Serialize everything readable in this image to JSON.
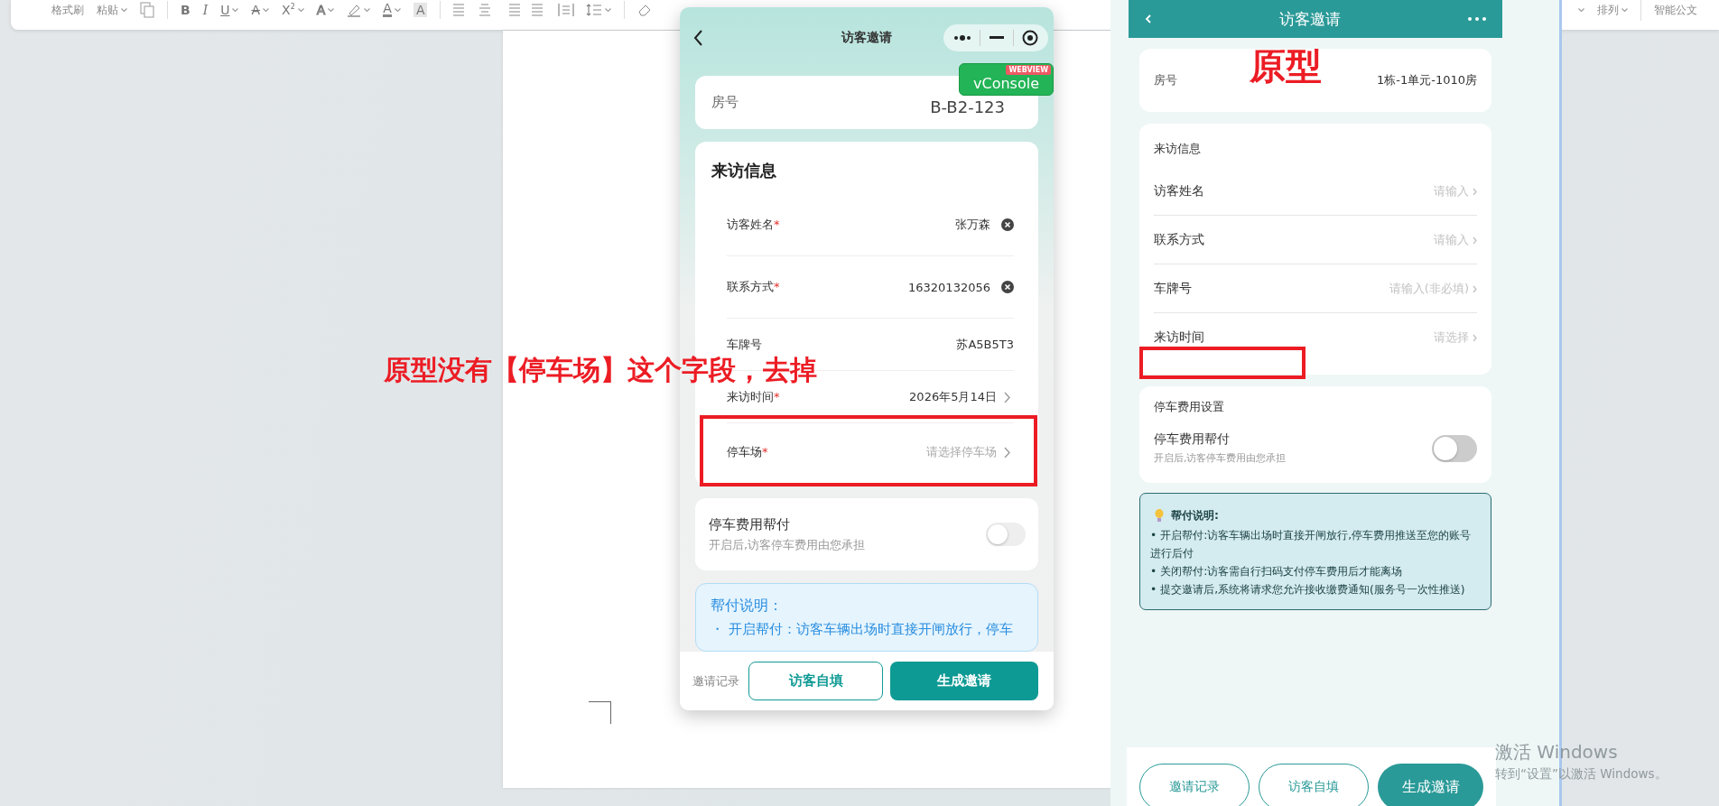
{
  "toolbar": {
    "left_items": [
      {
        "label": "格式刷",
        "dropdown": false
      },
      {
        "label": "粘贴",
        "dropdown": true
      }
    ],
    "format_buttons": [
      {
        "glyph": "B",
        "kind": "bold",
        "dropdown": false
      },
      {
        "glyph": "I",
        "kind": "italic",
        "dropdown": false
      },
      {
        "glyph": "U",
        "kind": "underline",
        "dropdown": true
      },
      {
        "glyph": "A",
        "kind": "strike",
        "dropdown": true
      },
      {
        "glyph": "X$^{2}$",
        "kind": "super",
        "dropdown": true
      },
      {
        "glyph": "A",
        "kind": "outline",
        "dropdown": true
      },
      {
        "glyph": "A",
        "kind": "color",
        "dropdown": true
      },
      {
        "glyph": "A",
        "kind": "shaded",
        "dropdown": false
      }
    ],
    "right_items": [
      {
        "label": "排列",
        "dropdown": true
      },
      {
        "label": "智能公文",
        "dropdown": false
      }
    ]
  },
  "preview": {
    "title": "访客邀请",
    "vconsole": {
      "label": "vConsole",
      "ribbon": "WEBVIEW"
    },
    "room": {
      "label": "房号",
      "value": "B-B2-123"
    },
    "section_title": "来访信息",
    "fields": [
      {
        "label": "访客姓名",
        "asterisk": "*",
        "value": "张万森",
        "kind": "clearable"
      },
      {
        "label": "联系方式",
        "asterisk": "*",
        "value": "16320132056",
        "kind": "clearable"
      },
      {
        "label": "车牌号",
        "value": "苏A5B5T3",
        "kind": "text"
      },
      {
        "label": "来访时间",
        "asterisk": "*",
        "value": "2026年5月14日",
        "kind": "picker"
      },
      {
        "label": "停车场",
        "asterisk": "*",
        "placeholder": "请选择停车场",
        "kind": "picker"
      }
    ],
    "fee": {
      "title": "停车费用帮付",
      "note": "开启后,访客停车费用由您承担",
      "on": false
    },
    "help": {
      "title": "帮付说明：",
      "lines": [
        "・ 开启帮付：访客车辆出场时直接开闸放行，停车"
      ]
    },
    "bottom": {
      "link": "邀请记录",
      "secondary": "访客自填",
      "primary": "生成邀请"
    }
  },
  "prototype": {
    "title": "访客邀请",
    "room": {
      "label": "房号",
      "value": "1栋-1单元-1010房"
    },
    "section_title": "来访信息",
    "fields": [
      {
        "label": "访客姓名",
        "placeholder": "请输入"
      },
      {
        "label": "联系方式",
        "placeholder": "请输入"
      },
      {
        "label": "车牌号",
        "placeholder": "请输入(非必填)"
      },
      {
        "label": "来访时间",
        "placeholder": "请选择"
      }
    ],
    "fee_section": "停车费用设置",
    "fee": {
      "title": "停车费用帮付",
      "note": "开启后,访客停车费用由您承担",
      "on": false
    },
    "help": {
      "title": "帮付说明:",
      "lines": [
        "• 开启帮付:访客车辆出场时直接开闸放行,停车费用推送至您的账号进行后付",
        "• 关闭帮付:访客需自行扫码支付停车费用后才能离场",
        "• 提交邀请后,系统将请求您允许接收缴费通知(服务号一次性推送)"
      ]
    },
    "buttons": [
      {
        "label": "邀请记录",
        "primary": false
      },
      {
        "label": "访客自填",
        "primary": false
      },
      {
        "label": "生成邀请",
        "primary": true
      }
    ]
  },
  "annotations": [
    {
      "text": "原型没有【停车场】这个字段，去掉",
      "kind": "comment"
    },
    {
      "text": "原型",
      "kind": "tag"
    }
  ],
  "os_notice": {
    "title": "激活 Windows",
    "subtitle": "转到“设置”以激活 Windows。"
  }
}
